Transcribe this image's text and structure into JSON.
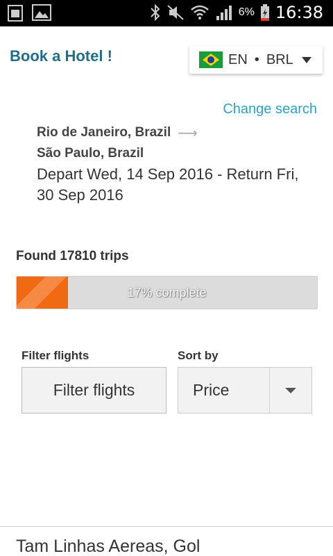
{
  "status_bar": {
    "battery_percent": "6%",
    "time": "16:38",
    "icons": [
      "sim-card-icon",
      "image-icon",
      "bluetooth-icon",
      "mute-icon",
      "wifi-icon",
      "signal-icon",
      "battery-charging-icon"
    ]
  },
  "header": {
    "title": "Book a Hotel !",
    "language": "EN",
    "separator": "•",
    "currency": "BRL",
    "flag": "brazil-flag-icon"
  },
  "search": {
    "change_label": "Change search",
    "origin": "Rio de Janeiro, Brazil",
    "destination": "São Paulo, Brazil",
    "dates": "Depart Wed, 14 Sep 2016 - Return Fri, 30 Sep 2016"
  },
  "results": {
    "found_text": "Found 17810 trips",
    "progress_percent": 17,
    "progress_text": "17% complete"
  },
  "controls": {
    "filter_label": "Filter flights",
    "filter_button": "Filter flights",
    "sort_label": "Sort by",
    "sort_value": "Price"
  },
  "list": {
    "first_airline": "Tam Linhas Aereas, Gol"
  },
  "colors": {
    "accent": "#1f6e8c",
    "link": "#2aa3c9",
    "progress": "#f06a14"
  }
}
